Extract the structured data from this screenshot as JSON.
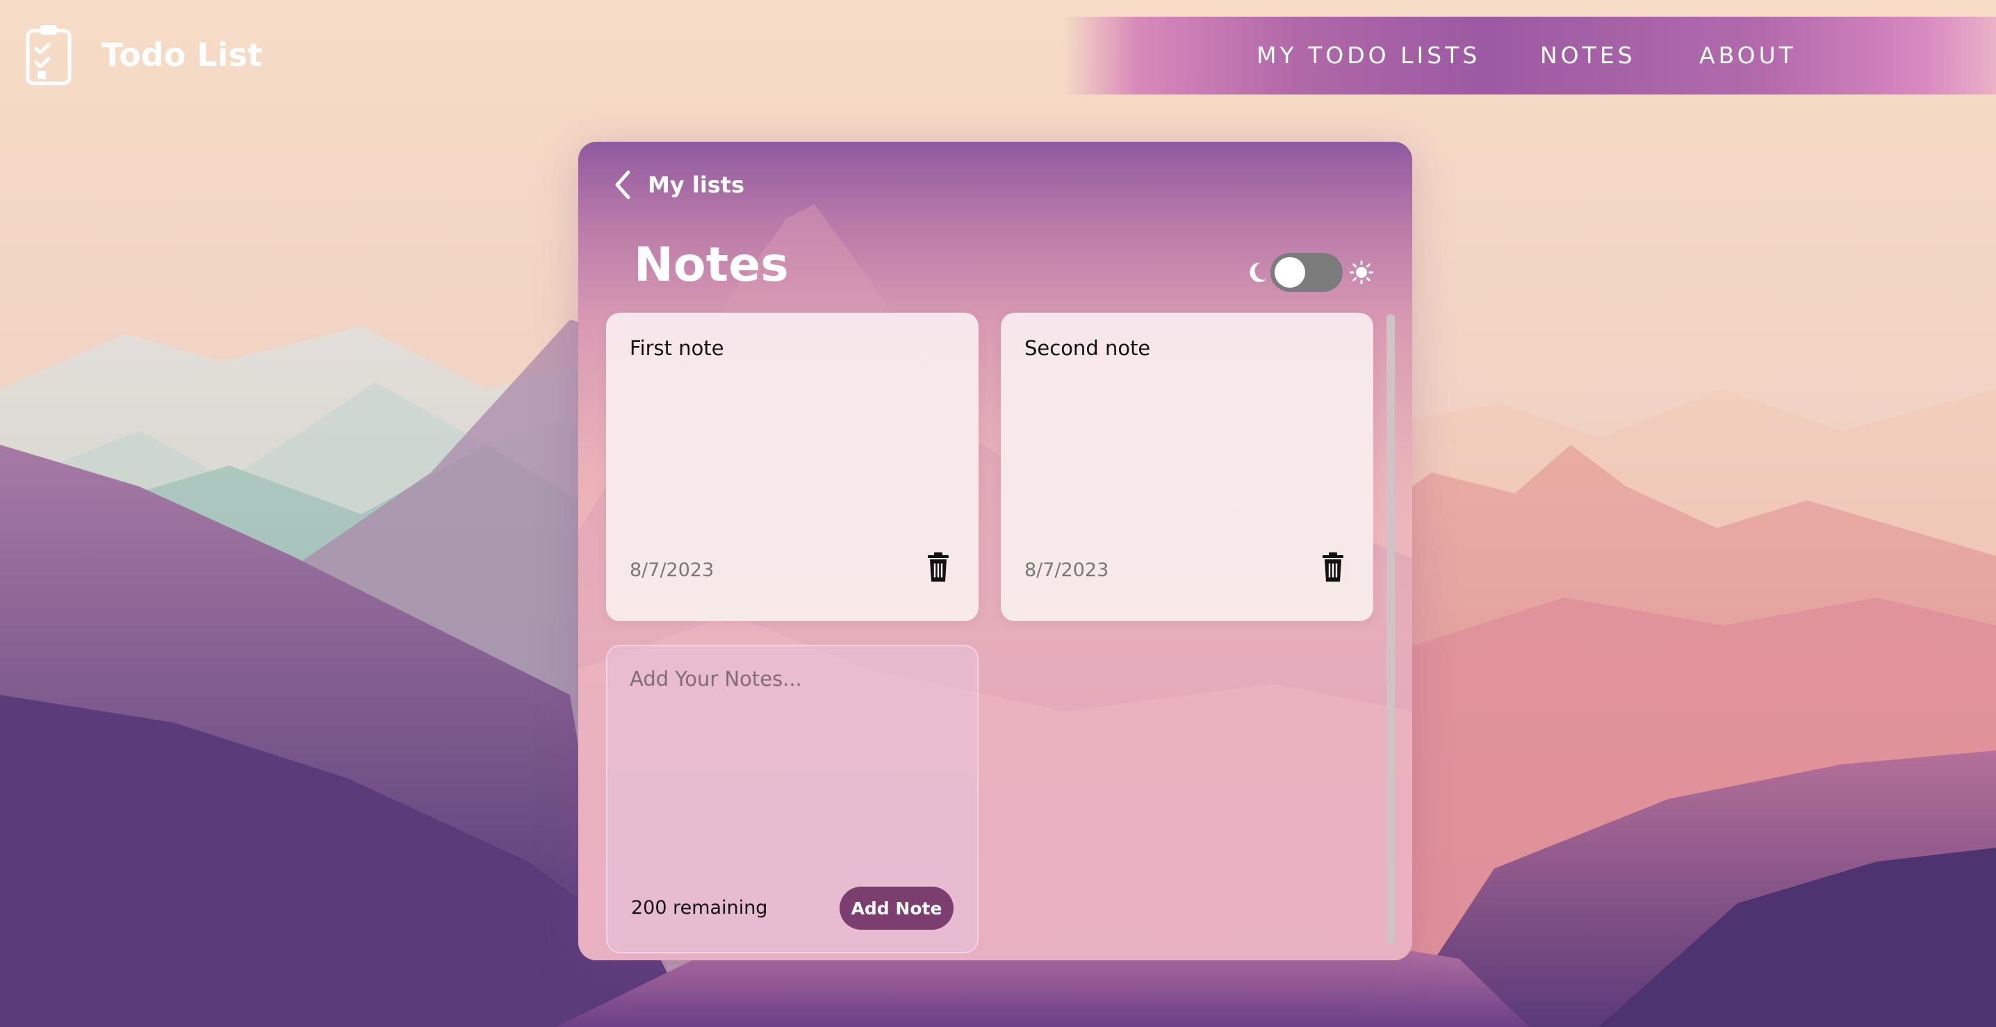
{
  "app": {
    "name": "Todo List",
    "logo_icon": "clipboard-checklist-icon"
  },
  "nav": {
    "items": [
      {
        "label": "MY TODO LISTS"
      },
      {
        "label": "NOTES"
      },
      {
        "label": "ABOUT"
      }
    ]
  },
  "panel": {
    "back_label": "My lists",
    "back_icon": "chevron-left-icon",
    "title": "Notes",
    "theme_toggle": {
      "left_icon": "moon-icon",
      "right_icon": "sun-icon",
      "state": "off"
    }
  },
  "notes": [
    {
      "text": "First note",
      "date": "8/7/2023",
      "delete_icon": "trash-icon"
    },
    {
      "text": "Second note",
      "date": "8/7/2023",
      "delete_icon": "trash-icon"
    }
  ],
  "composer": {
    "placeholder": "Add Your Notes...",
    "remaining": "200 remaining",
    "button_label": "Add Note"
  },
  "colors": {
    "button": "#7b3e6e",
    "toggle_track": "#7b7b7b",
    "nav_accent": "#9c5aa2",
    "panel_top": "#8f5aa0"
  }
}
